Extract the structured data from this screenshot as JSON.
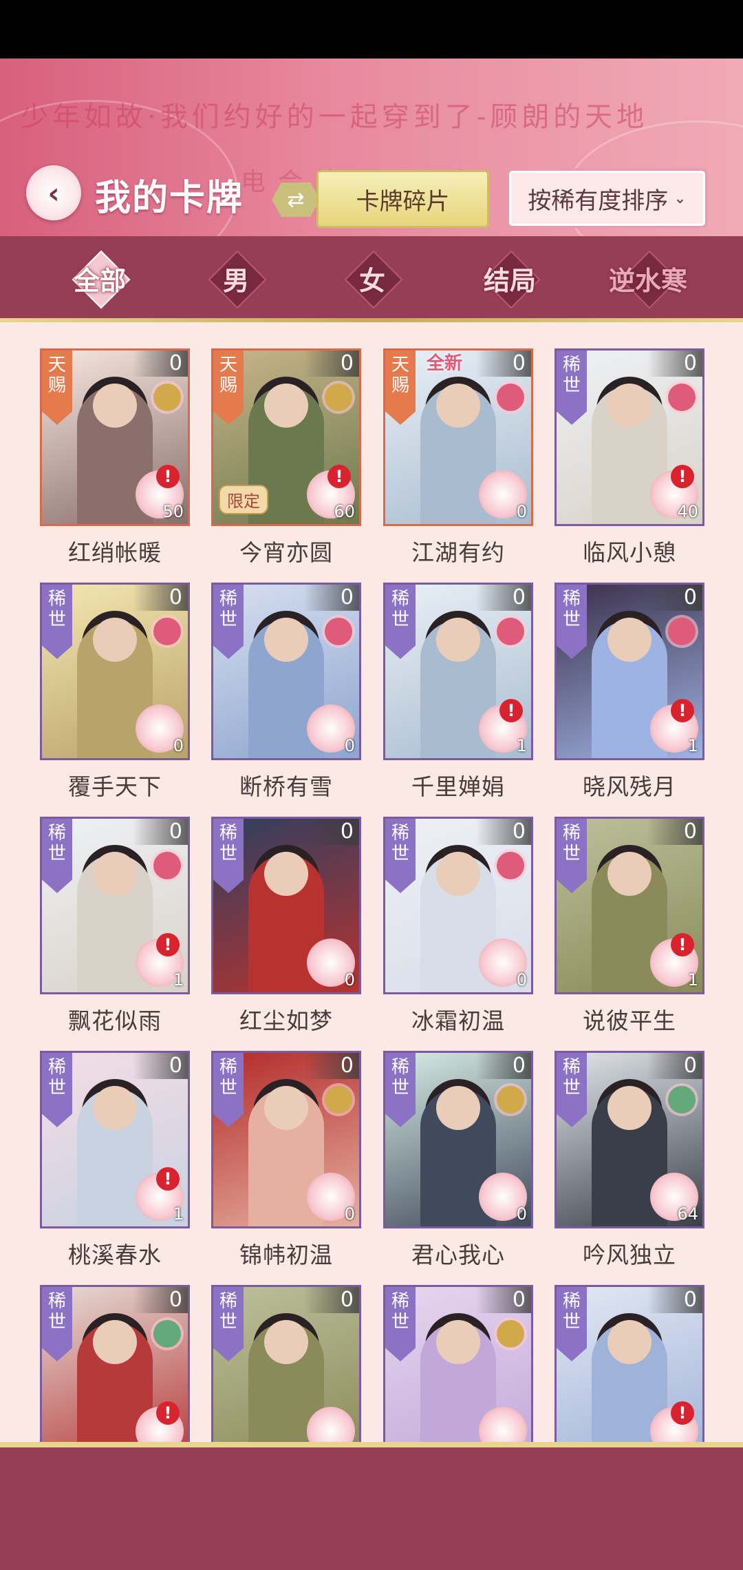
{
  "header": {
    "banner_text": "少年如故·我们约好的一起穿到了-顾朗的天地",
    "banner_text2": "电合等目·寻欢",
    "title": "我的卡牌",
    "fragments_label": "卡牌碎片",
    "sort_label": "按稀有度排序"
  },
  "tabs": [
    {
      "label": "全部",
      "active": true
    },
    {
      "label": "男",
      "active": false
    },
    {
      "label": "女",
      "active": false
    },
    {
      "label": "结局",
      "active": false
    },
    {
      "label": "逆水寒",
      "active": false
    }
  ],
  "cards": [
    {
      "name": "红绡帐暖",
      "rarity": "天赐",
      "count": "0",
      "fragments": "50",
      "alert": true,
      "extra": "",
      "flower": "gold",
      "palette": "warm"
    },
    {
      "name": "今宵亦圆",
      "rarity": "天赐",
      "count": "0",
      "fragments": "60",
      "alert": true,
      "extra": "限定",
      "flower": "gold",
      "palette": "green"
    },
    {
      "name": "江湖有约",
      "rarity": "天赐",
      "count": "0",
      "fragments": "0",
      "alert": false,
      "extra": "全新",
      "flower": "pink",
      "palette": "snow"
    },
    {
      "name": "临风小憩",
      "rarity": "稀世",
      "count": "0",
      "fragments": "40",
      "alert": true,
      "extra": "",
      "flower": "pink",
      "palette": "light"
    },
    {
      "name": "覆手天下",
      "rarity": "稀世",
      "count": "0",
      "fragments": "0",
      "alert": false,
      "extra": "",
      "flower": "pink",
      "palette": "gold"
    },
    {
      "name": "断桥有雪",
      "rarity": "稀世",
      "count": "0",
      "fragments": "0",
      "alert": false,
      "extra": "",
      "flower": "pink",
      "palette": "blue"
    },
    {
      "name": "千里婵娟",
      "rarity": "稀世",
      "count": "0",
      "fragments": "1",
      "alert": true,
      "extra": "",
      "flower": "pink",
      "palette": "snow"
    },
    {
      "name": "晓风残月",
      "rarity": "稀世",
      "count": "0",
      "fragments": "1",
      "alert": true,
      "extra": "",
      "flower": "pink",
      "palette": "night"
    },
    {
      "name": "飘花似雨",
      "rarity": "稀世",
      "count": "0",
      "fragments": "1",
      "alert": true,
      "extra": "",
      "flower": "pink",
      "palette": "light"
    },
    {
      "name": "红尘如梦",
      "rarity": "稀世",
      "count": "0",
      "fragments": "0",
      "alert": false,
      "extra": "",
      "flower": "none",
      "palette": "darkblue"
    },
    {
      "name": "冰霜初温",
      "rarity": "稀世",
      "count": "0",
      "fragments": "0",
      "alert": false,
      "extra": "",
      "flower": "pink",
      "palette": "white"
    },
    {
      "name": "说彼平生",
      "rarity": "稀世",
      "count": "0",
      "fragments": "1",
      "alert": true,
      "extra": "",
      "flower": "none",
      "palette": "olive"
    },
    {
      "name": "桃溪春水",
      "rarity": "稀世",
      "count": "0",
      "fragments": "1",
      "alert": true,
      "extra": "",
      "flower": "none",
      "palette": "pinkmist"
    },
    {
      "name": "锦帏初温",
      "rarity": "稀世",
      "count": "0",
      "fragments": "0",
      "alert": false,
      "extra": "",
      "flower": "gold",
      "palette": "red"
    },
    {
      "name": "君心我心",
      "rarity": "稀世",
      "count": "0",
      "fragments": "0",
      "alert": false,
      "extra": "",
      "flower": "gold",
      "palette": "mint"
    },
    {
      "name": "吟风独立",
      "rarity": "稀世",
      "count": "0",
      "fragments": "64",
      "alert": false,
      "extra": "",
      "flower": "green",
      "palette": "grey"
    },
    {
      "name": "",
      "rarity": "稀世",
      "count": "0",
      "fragments": "",
      "alert": true,
      "extra": "",
      "flower": "green",
      "palette": "redwhite"
    },
    {
      "name": "",
      "rarity": "稀世",
      "count": "0",
      "fragments": "",
      "alert": false,
      "extra": "",
      "flower": "none",
      "palette": "olive"
    },
    {
      "name": "",
      "rarity": "稀世",
      "count": "0",
      "fragments": "",
      "alert": false,
      "extra": "",
      "flower": "gold",
      "palette": "lilac"
    },
    {
      "name": "",
      "rarity": "稀世",
      "count": "0",
      "fragments": "",
      "alert": true,
      "extra": "",
      "flower": "none",
      "palette": "lightblue"
    }
  ],
  "colors": {
    "header_pink": "#d8607d",
    "tab_bar": "#963e55",
    "rarity_purple": "#8b72c4",
    "rarity_orange": "#e57a4c",
    "content_bg": "#fbe9e6"
  }
}
